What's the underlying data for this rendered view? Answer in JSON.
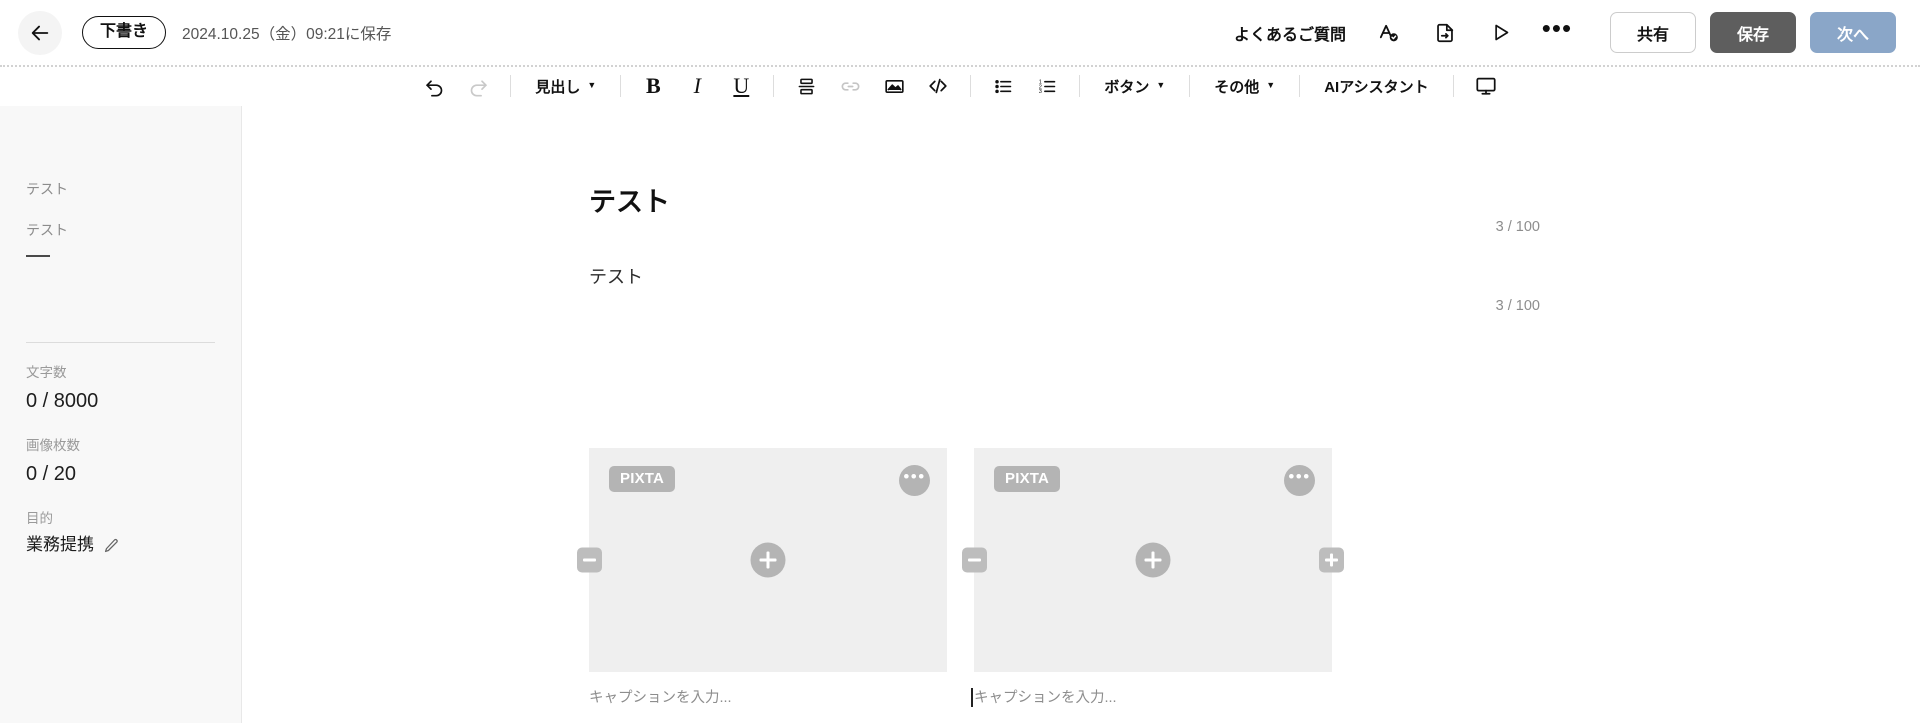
{
  "header": {
    "back_icon": "arrow-left-icon",
    "status_badge": "下書き",
    "saved_at": "2024.10.25（金）09:21に保存",
    "faq_link": "よくあるご質問",
    "icons": [
      {
        "name": "spellcheck-icon"
      },
      {
        "name": "document-export-icon"
      },
      {
        "name": "play-icon"
      },
      {
        "name": "more-horizontal-icon",
        "glyph": "•••"
      }
    ],
    "buttons": {
      "share": "共有",
      "save": "保存",
      "next": "次へ"
    },
    "colors": {
      "save_bg": "#5e5e5e",
      "next_bg": "#8aa6c8",
      "share_border": "#cccccc"
    }
  },
  "toolbar": {
    "undo": "undo-icon",
    "redo": "redo-icon",
    "heading": "見出し",
    "bold": "B",
    "italic": "I",
    "underline": "U",
    "divider_block": "horizontal-divider-icon",
    "link": "link-icon",
    "image": "image-icon",
    "code": "code-icon",
    "bullet_list": "bullet-list-icon",
    "numbered_list": "numbered-list-icon",
    "button_menu": "ボタン",
    "other_menu": "その他",
    "ai_assistant": "AIアシスタント",
    "preview": "monitor-preview-icon"
  },
  "sidebar": {
    "outline": [
      {
        "label": "テスト"
      },
      {
        "label": "テスト"
      }
    ],
    "stats": [
      {
        "label": "文字数",
        "value": "0 / 8000"
      },
      {
        "label": "画像枚数",
        "value": "0 / 20"
      }
    ],
    "purpose": {
      "label": "目的",
      "value": "業務提携",
      "edit_icon": "pencil-icon"
    }
  },
  "document": {
    "title": "テスト",
    "title_counter": "3 / 100",
    "subtitle": "テスト",
    "subtitle_counter": "3 / 100",
    "images": [
      {
        "badge": "PIXTA",
        "more_icon": "more-horizontal-icon",
        "add_icon": "plus-icon",
        "left_handle": "remove-column-icon",
        "caption_placeholder": "キャプションを入力..."
      },
      {
        "badge": "PIXTA",
        "more_icon": "more-horizontal-icon",
        "add_icon": "plus-icon",
        "left_handle": "remove-column-icon",
        "right_handle": "add-column-icon",
        "caption_placeholder": "キャプションを入力..."
      }
    ]
  }
}
